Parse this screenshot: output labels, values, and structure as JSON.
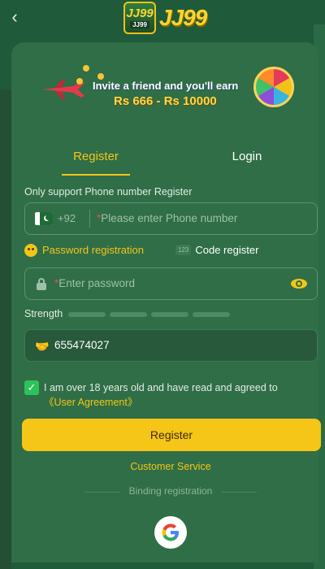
{
  "header": {
    "back_icon": "chevron-left-icon",
    "logo_badge_big": "JJ99",
    "logo_badge_small": "JJ99",
    "logo_text": "JJ99"
  },
  "banner": {
    "line1": "Invite a friend and you'll earn",
    "line2": "Rs 666 - Rs 10000"
  },
  "tabs": {
    "register": "Register",
    "login": "Login"
  },
  "form": {
    "hint": "Only support Phone number Register",
    "country_code": "+92",
    "phone_placeholder": "Please enter Phone number",
    "mode_password": "Password registration",
    "mode_code_icon": "123",
    "mode_code": "Code register",
    "password_placeholder": "Enter password",
    "required_mark": "*",
    "strength_label": "Strength",
    "referral_value": "655474027",
    "agree_text": "I am over 18 years old and have read and agreed to ",
    "agree_link": "《User Agreement》",
    "register_button": "Register",
    "customer_service": "Customer Service",
    "binding_label": "Binding registration"
  },
  "colors": {
    "accent": "#f5c518",
    "background": "#2f6e46",
    "checkbox": "#2ec25a"
  }
}
